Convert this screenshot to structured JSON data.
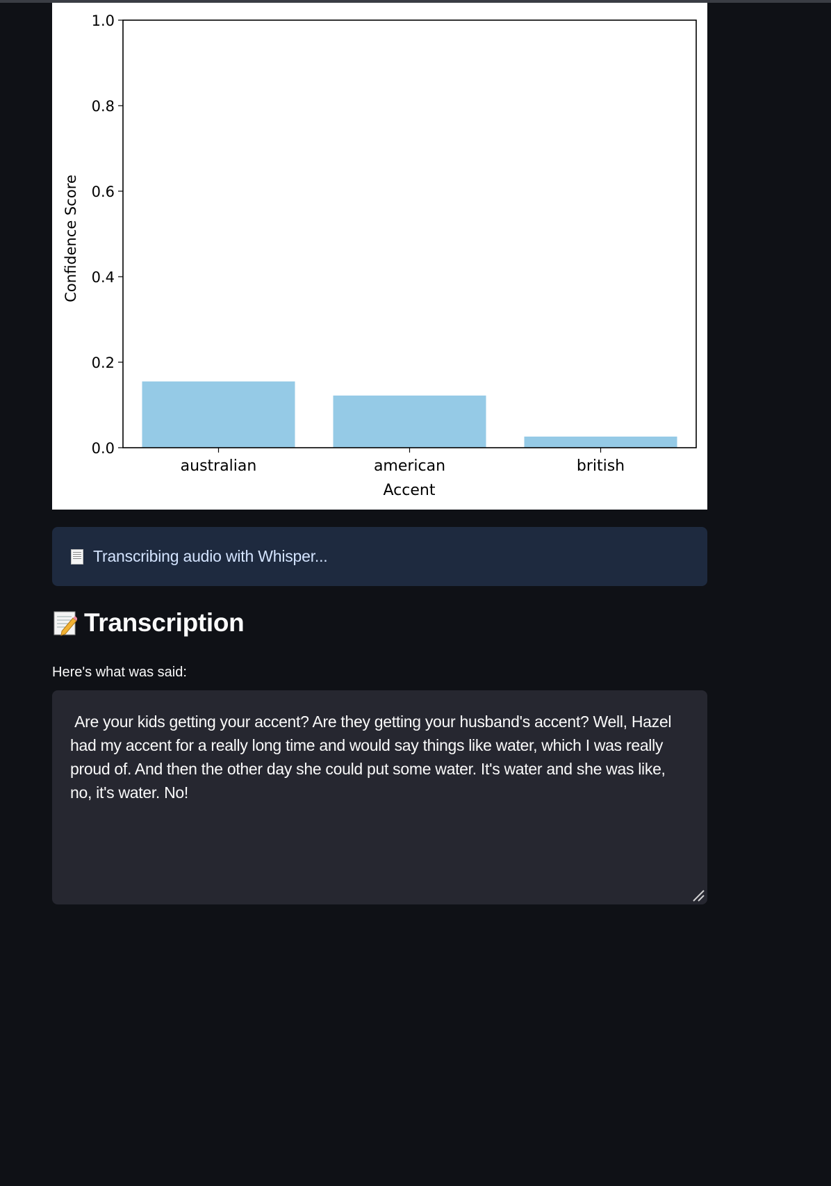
{
  "chart_data": {
    "type": "bar",
    "categories": [
      "australian",
      "american",
      "british"
    ],
    "values": [
      0.155,
      0.122,
      0.026
    ],
    "xlabel": "Accent",
    "ylabel": "Confidence Score",
    "ylim": [
      0,
      1.0
    ],
    "yticks": [
      "0.0",
      "0.2",
      "0.4",
      "0.6",
      "0.8",
      "1.0"
    ],
    "bar_color": "#95cae6",
    "grid": false
  },
  "info": {
    "icon": "page-with-text-icon",
    "text": "Transcribing audio with Whisper..."
  },
  "transcription": {
    "icon": "memo-icon",
    "heading": "Transcription",
    "label": "Here's what was said:",
    "text": " Are your kids getting your accent? Are they getting your husband's accent? Well, Hazel had my accent for a really long time and would say things like water, which I was really proud of. And then the other day she could put some water. It's water and she was like, no, it's water. No!"
  },
  "colors": {
    "page_bg": "#0f1116",
    "info_bg": "#1e2a3f",
    "info_text": "#d4e4ff",
    "textarea_bg": "#262730",
    "text": "#fafafa"
  }
}
